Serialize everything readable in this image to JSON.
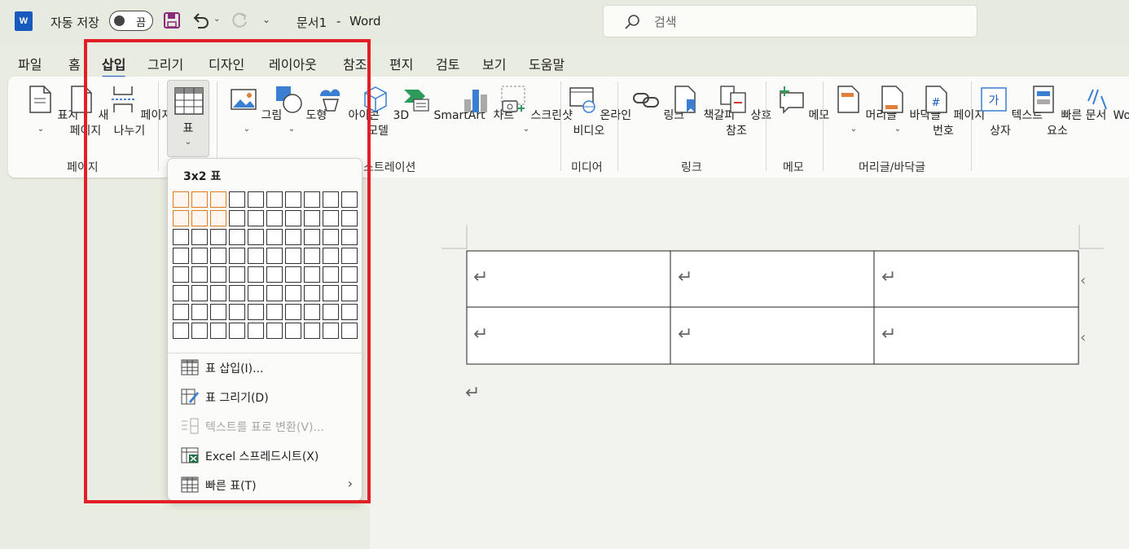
{
  "titlebar": {
    "autosave_label": "자동 저장",
    "autosave_state": "끔",
    "document_title": "문서1",
    "title_separator": "-",
    "app_name": "Word",
    "app_logo": "W",
    "search_placeholder": "검색"
  },
  "tabs": [
    {
      "label": "파일"
    },
    {
      "label": "홈"
    },
    {
      "label": "삽입"
    },
    {
      "label": "그리기"
    },
    {
      "label": "디자인"
    },
    {
      "label": "레이아웃"
    },
    {
      "label": "참조"
    },
    {
      "label": "편지"
    },
    {
      "label": "검토"
    },
    {
      "label": "보기"
    },
    {
      "label": "도움말"
    }
  ],
  "active_tab": "삽입",
  "ribbon": {
    "cover": {
      "line1": "표지"
    },
    "blank_page": {
      "line1": "새",
      "line2": "페이지"
    },
    "page_break": {
      "line1": "페이지",
      "line2": "나누기"
    },
    "table": {
      "line1": "표"
    },
    "picture": {
      "line1": "그림"
    },
    "shapes": {
      "line1": "도형"
    },
    "icons": {
      "line1": "아이콘"
    },
    "model3d": {
      "line1": "3D",
      "line2": "모델"
    },
    "smartart": {
      "line1": "SmartArt"
    },
    "chart": {
      "line1": "차트"
    },
    "screenshot": {
      "line1": "스크린샷"
    },
    "online_video": {
      "line1": "온라인",
      "line2": "비디오"
    },
    "link": {
      "line1": "링크"
    },
    "bookmark": {
      "line1": "책갈피"
    },
    "crossref": {
      "line1": "상호",
      "line2": "참조"
    },
    "comment": {
      "line1": "메모"
    },
    "header": {
      "line1": "머리글"
    },
    "footer": {
      "line1": "바닥글"
    },
    "page_number": {
      "line1": "페이지",
      "line2": "번호"
    },
    "textbox": {
      "line1": "텍스트",
      "line2": "상자"
    },
    "quickparts": {
      "line1": "빠른 문서",
      "line2": "요소"
    },
    "wordart": {
      "line1": "WordArt"
    },
    "textbox_glyph": "가",
    "pagenum_glyph": "#",
    "groups": {
      "pages": "페이지",
      "illustrations": "스트레이션",
      "media": "미디어",
      "links": "링크",
      "comments": "메모",
      "header_footer": "머리글/바닥글"
    }
  },
  "table_dropdown": {
    "title": "3x2 표",
    "grid_columns": 10,
    "grid_rows": 8,
    "selected_columns": 3,
    "selected_rows": 2,
    "items": [
      {
        "label": "표 삽입(I)...",
        "disabled": false
      },
      {
        "label": "표 그리기(D)",
        "disabled": false
      },
      {
        "label": "텍스트를 표로 변환(V)...",
        "disabled": true
      },
      {
        "label": "Excel 스프레드시트(X)",
        "disabled": false
      },
      {
        "label": "빠른 표(T)",
        "disabled": false,
        "submenu": true
      }
    ]
  },
  "document": {
    "table_rows": 2,
    "table_columns": 3,
    "paragraph_mark": "↵"
  },
  "colors": {
    "accent": "#185abd",
    "highlight_box": "#e21f26",
    "grid_selected": "#e07a1f"
  }
}
